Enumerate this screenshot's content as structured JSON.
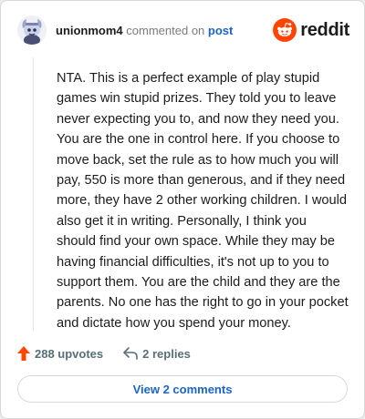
{
  "header": {
    "username": "unionmom4",
    "action_text": "commented on",
    "post_link": "post",
    "brand": "reddit",
    "avatar_icon": "snoo-avatar-icon",
    "brand_icon": "reddit-logo-icon"
  },
  "comment": {
    "text": "NTA. This is a perfect example of play stupid games win stupid prizes. They told you to leave never expecting you to, and now they need you. You are the one in control here. If you choose to move back, set the rule as to how much you will pay, 550 is more than generous, and if they need more, they have 2 other working children. I would also get it in writing. Personally, I think you should find your own space. While they may be having financial difficulties, it's not up to you to support them. You are the child and they are the parents. No one has the right to go in your pocket and dictate how you spend your money."
  },
  "actions": {
    "upvotes": "288 upvotes",
    "replies": "2 replies",
    "upvote_icon": "upvote-arrow-icon",
    "reply_icon": "reply-arrow-icon"
  },
  "footer": {
    "view_comments": "View 2 comments"
  },
  "colors": {
    "accent": "#ff4500",
    "link": "#1b64c9",
    "text": "#1c1c1c",
    "muted": "#576f76"
  }
}
